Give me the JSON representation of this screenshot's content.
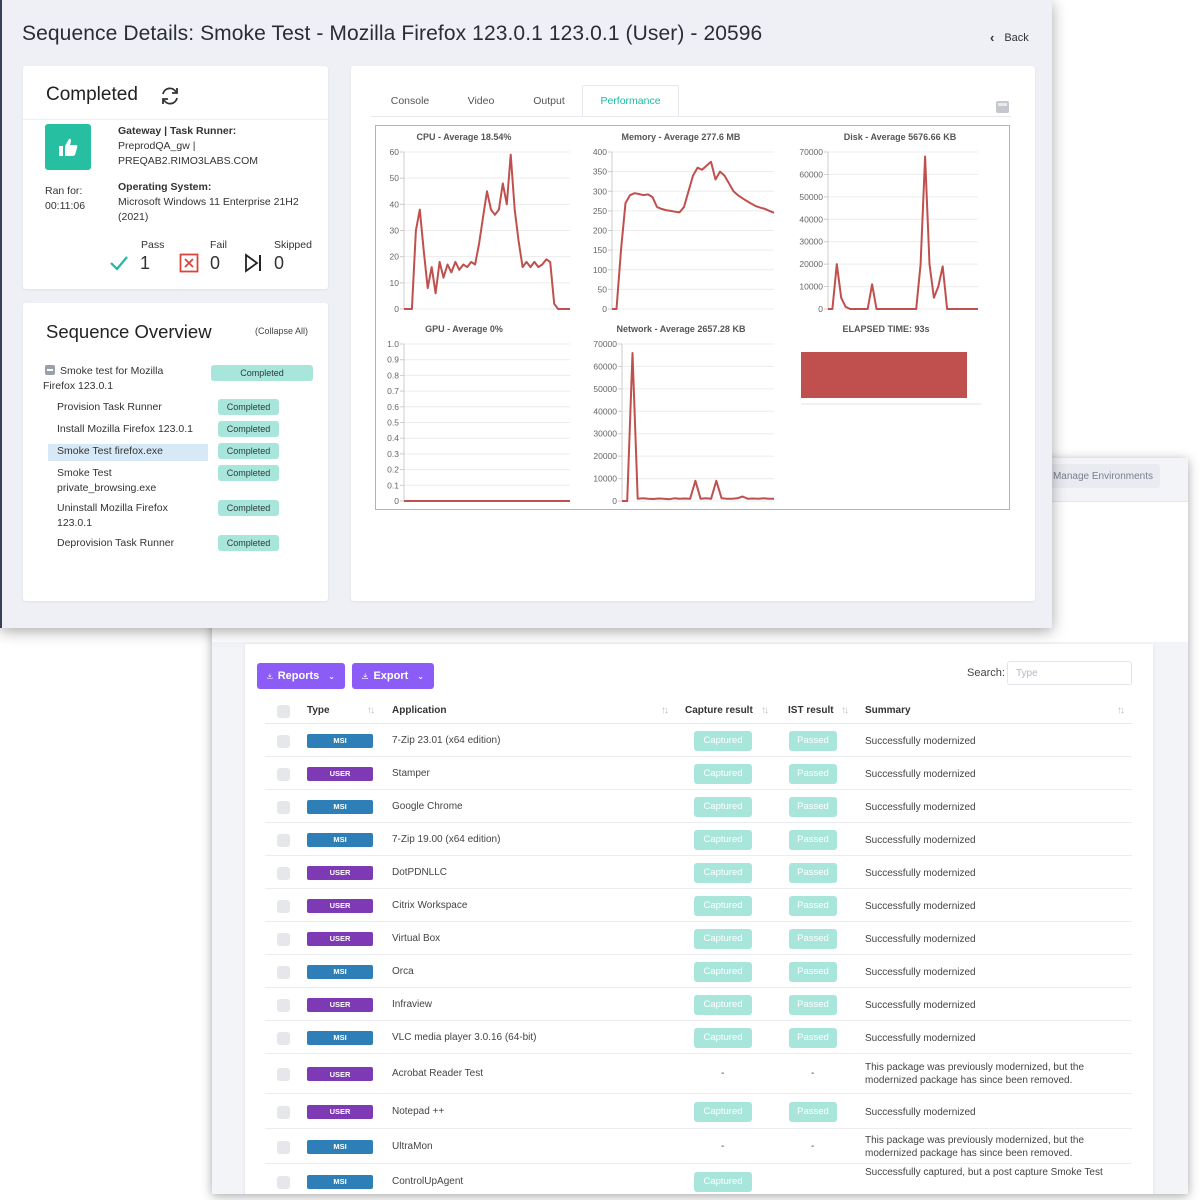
{
  "page_title": "Sequence Details: Smoke Test - Mozilla Firefox 123.0.1 123.0.1 (User) - 20596",
  "back_label": "Back",
  "status_card": {
    "status": "Completed",
    "ran_for_label": "Ran for:",
    "ran_for_value": "00:11:06",
    "gateway_label": "Gateway | Task Runner:",
    "gateway_line1": "PreprodQA_gw |",
    "gateway_line2": "PREQAB2.RIMO3LABS.COM",
    "os_label": "Operating System:",
    "os_line1": "Microsoft Windows 11 Enterprise 21H2",
    "os_line2": "(2021)",
    "pass_label": "Pass",
    "pass_value": "1",
    "fail_label": "Fail",
    "fail_value": "0",
    "skipped_label": "Skipped",
    "skipped_value": "0"
  },
  "overview": {
    "title": "Sequence Overview",
    "collapse_label": "(Collapse All)",
    "parent_line1": "Smoke test for Mozilla",
    "parent_line2": "Firefox 123.0.1",
    "parent_status": "Completed",
    "steps": [
      {
        "line1": "Provision Task Runner",
        "line2": "",
        "status": "Completed"
      },
      {
        "line1": "Install Mozilla Firefox 123.0.1",
        "line2": "",
        "status": "Completed"
      },
      {
        "line1": "Smoke Test firefox.exe",
        "line2": "",
        "status": "Completed"
      },
      {
        "line1": "Smoke Test",
        "line2": "private_browsing.exe",
        "status": "Completed"
      },
      {
        "line1": "Uninstall Mozilla Firefox",
        "line2": "123.0.1",
        "status": "Completed"
      },
      {
        "line1": "Deprovision Task Runner",
        "line2": "",
        "status": "Completed"
      }
    ]
  },
  "tabs": [
    "Console",
    "Video",
    "Output",
    "Performance"
  ],
  "active_tab": "Performance",
  "colors": {
    "line": "#c0504d",
    "teal": "#1fb9a0",
    "badge": "#a8e6dc",
    "purple_button": "#8b5cf6",
    "msi": "#2e7fb8",
    "user": "#7e3ab5"
  },
  "chart_data": [
    {
      "type": "line",
      "title": "CPU - Average 18.54%",
      "ylim": [
        0,
        60
      ],
      "yticks": [
        "60",
        "50",
        "40",
        "30",
        "20",
        "10",
        "0"
      ],
      "y": [
        0,
        0,
        0,
        30,
        38,
        22,
        8,
        16,
        6,
        18,
        12,
        17,
        14,
        18,
        15,
        17,
        16,
        18,
        17,
        25,
        35,
        45,
        38,
        36,
        38,
        48,
        40,
        59,
        38,
        26,
        16,
        18,
        16,
        18,
        16,
        17,
        19,
        18,
        2,
        0,
        0,
        0,
        0
      ]
    },
    {
      "type": "line",
      "title": "Memory - Average 277.6 MB",
      "ylim": [
        0,
        400
      ],
      "yticks": [
        "400",
        "350",
        "300",
        "250",
        "200",
        "150",
        "100",
        "50",
        "0"
      ],
      "y": [
        0,
        0,
        150,
        270,
        290,
        295,
        293,
        290,
        292,
        285,
        260,
        255,
        252,
        250,
        248,
        246,
        260,
        300,
        340,
        360,
        355,
        365,
        375,
        330,
        350,
        340,
        320,
        300,
        290,
        282,
        275,
        268,
        262,
        258,
        255,
        250,
        245
      ]
    },
    {
      "type": "line",
      "title": "Disk - Average 5676.66 KB",
      "ylim": [
        0,
        70000
      ],
      "yticks": [
        "70000",
        "60000",
        "50000",
        "40000",
        "30000",
        "20000",
        "10000",
        "0"
      ],
      "y": [
        0,
        0,
        20000,
        5000,
        1000,
        0,
        0,
        0,
        0,
        0,
        11000,
        0,
        0,
        0,
        0,
        0,
        0,
        0,
        0,
        0,
        0,
        20000,
        68000,
        20000,
        5000,
        10000,
        19000,
        0,
        0,
        0,
        0,
        0,
        0,
        0,
        0
      ]
    },
    {
      "type": "line",
      "title": "GPU - Average 0%",
      "ylim": [
        0,
        1
      ],
      "yticks": [
        "1.0",
        "0.9",
        "0.8",
        "0.7",
        "0.6",
        "0.5",
        "0.4",
        "0.3",
        "0.2",
        "0.1",
        "0"
      ],
      "y": [
        0,
        0,
        0,
        0,
        0,
        0,
        0,
        0,
        0,
        0,
        0,
        0,
        0,
        0,
        0,
        0,
        0,
        0,
        0,
        0
      ]
    },
    {
      "type": "line",
      "title": "Network - Average 2657.28 KB",
      "ylim": [
        0,
        70000
      ],
      "yticks": [
        "70000",
        "60000",
        "50000",
        "40000",
        "30000",
        "20000",
        "10000",
        "0"
      ],
      "y": [
        0,
        0,
        66000,
        1000,
        1200,
        1000,
        900,
        1100,
        1000,
        800,
        1200,
        1000,
        1100,
        1000,
        9000,
        1000,
        1200,
        1000,
        9000,
        1200,
        1000,
        1000,
        1200,
        2000,
        1000,
        1100,
        1000,
        1200,
        1000,
        1000
      ]
    },
    {
      "type": "bar",
      "title": "ELAPSED TIME: 93s",
      "values": [
        93
      ]
    }
  ],
  "table": {
    "reports_label": "Reports",
    "export_label": "Export",
    "search_label": "Search:",
    "search_placeholder": "Type",
    "columns": [
      "Type",
      "Application",
      "Capture result",
      "IST result",
      "Summary"
    ],
    "manage_env_label": "Manage Environments",
    "rows": [
      {
        "type": "MSI",
        "app": "7-Zip 23.01 (x64 edition)",
        "capture": "Captured",
        "ist": "Passed",
        "summary1": "Successfully modernized",
        "summary2": ""
      },
      {
        "type": "USER",
        "app": "Stamper",
        "capture": "Captured",
        "ist": "Passed",
        "summary1": "Successfully modernized",
        "summary2": ""
      },
      {
        "type": "MSI",
        "app": "Google Chrome",
        "capture": "Captured",
        "ist": "Passed",
        "summary1": "Successfully modernized",
        "summary2": ""
      },
      {
        "type": "MSI",
        "app": "7-Zip 19.00 (x64 edition)",
        "capture": "Captured",
        "ist": "Passed",
        "summary1": "Successfully modernized",
        "summary2": ""
      },
      {
        "type": "USER",
        "app": "DotPDNLLC",
        "capture": "Captured",
        "ist": "Passed",
        "summary1": "Successfully modernized",
        "summary2": ""
      },
      {
        "type": "USER",
        "app": "Citrix Workspace",
        "capture": "Captured",
        "ist": "Passed",
        "summary1": "Successfully modernized",
        "summary2": ""
      },
      {
        "type": "USER",
        "app": "Virtual Box",
        "capture": "Captured",
        "ist": "Passed",
        "summary1": "Successfully modernized",
        "summary2": ""
      },
      {
        "type": "MSI",
        "app": "Orca",
        "capture": "Captured",
        "ist": "Passed",
        "summary1": "Successfully modernized",
        "summary2": ""
      },
      {
        "type": "USER",
        "app": "Infraview",
        "capture": "Captured",
        "ist": "Passed",
        "summary1": "Successfully modernized",
        "summary2": ""
      },
      {
        "type": "MSI",
        "app": "VLC media player 3.0.16 (64-bit)",
        "capture": "Captured",
        "ist": "Passed",
        "summary1": "Successfully modernized",
        "summary2": ""
      },
      {
        "type": "USER",
        "app": "Acrobat Reader Test",
        "capture": "-",
        "ist": "-",
        "summary1": "This package was previously modernized, but the",
        "summary2": "modernized package has since been removed."
      },
      {
        "type": "USER",
        "app": "Notepad ++",
        "capture": "Captured",
        "ist": "Passed",
        "summary1": "Successfully modernized",
        "summary2": ""
      },
      {
        "type": "MSI",
        "app": "UltraMon",
        "capture": "-",
        "ist": "-",
        "summary1": "This package was previously modernized, but the",
        "summary2": "modernized package has since been removed."
      },
      {
        "type": "MSI",
        "app": "ControlUpAgent",
        "capture": "Captured",
        "ist": "",
        "summary1": "Successfully captured, but a post capture Smoke Test",
        "summary2": ""
      }
    ]
  }
}
